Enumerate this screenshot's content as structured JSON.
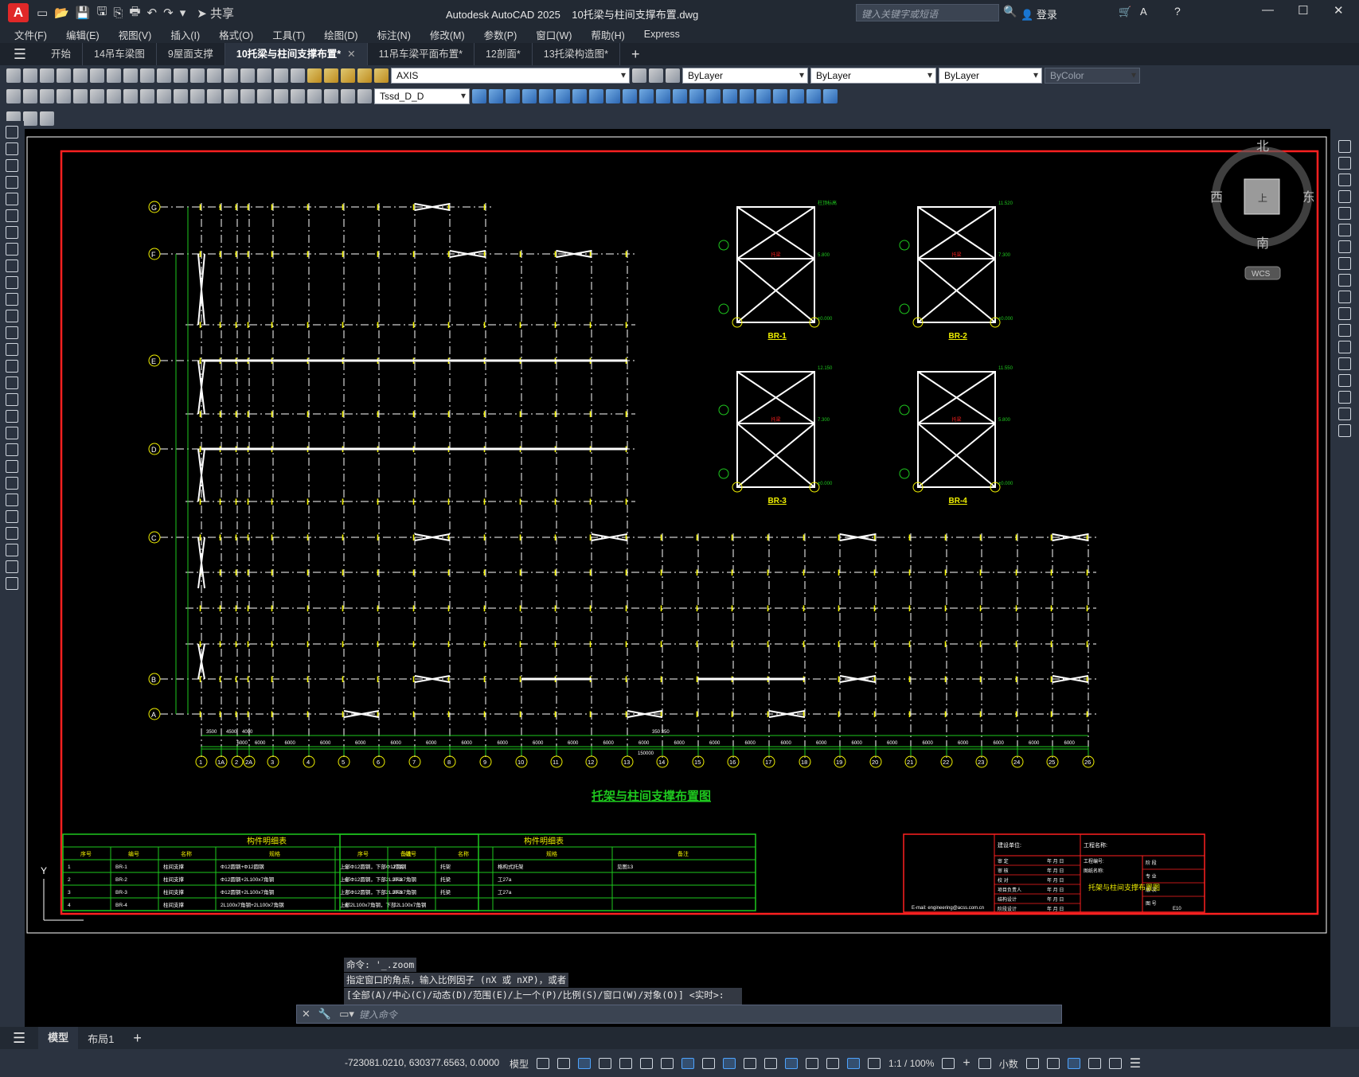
{
  "titlebar": {
    "logo": "A",
    "share": "共享",
    "app_title": "Autodesk AutoCAD 2025",
    "file_title": "10托梁与柱间支撑布置.dwg",
    "search_placeholder": "键入关键字或短语",
    "login": "登录"
  },
  "menu": [
    "文件(F)",
    "编辑(E)",
    "视图(V)",
    "插入(I)",
    "格式(O)",
    "工具(T)",
    "绘图(D)",
    "标注(N)",
    "修改(M)",
    "参数(P)",
    "窗口(W)",
    "帮助(H)",
    "Express"
  ],
  "tabs": [
    {
      "label": "开始"
    },
    {
      "label": "14吊车梁图"
    },
    {
      "label": "9屋面支撑"
    },
    {
      "label": "10托梁与柱间支撑布置*",
      "active": true
    },
    {
      "label": "11吊车梁平面布置*"
    },
    {
      "label": "12剖面*"
    },
    {
      "label": "13托梁构造图*"
    }
  ],
  "toolbar": {
    "layer": "AXIS",
    "color": "ByLayer",
    "linetype": "ByLayer",
    "lineweight": "ByLayer",
    "plotstyle": "ByColor",
    "dimstyle": "Tssd_D_D"
  },
  "compass": {
    "north": "北",
    "south": "南",
    "east": "东",
    "west": "西",
    "wcs": "WCS"
  },
  "drawing": {
    "title": "托架与柱间支撑布置图",
    "row_axes": [
      "G",
      "F",
      "E",
      "D",
      "C",
      "B",
      "A"
    ],
    "col_axes": [
      "1",
      "1A",
      "2",
      "2A",
      "3",
      "4",
      "5",
      "6",
      "7",
      "8",
      "9",
      "10",
      "11",
      "12",
      "13",
      "14",
      "15",
      "16",
      "17",
      "18",
      "19",
      "20",
      "21",
      "22",
      "23",
      "24",
      "25",
      "26"
    ],
    "bay_dims_top": [
      "3500",
      "4500",
      "4000"
    ],
    "bay_dims": [
      "6000",
      "6000",
      "6000",
      "6000",
      "6000",
      "6000",
      "6000",
      "6000",
      "6000",
      "6000",
      "6000",
      "6000",
      "6000",
      "6000",
      "6000",
      "6000",
      "6000",
      "6000",
      "6000",
      "6000",
      "6000",
      "6000",
      "6000",
      "6000",
      "6000"
    ],
    "total_dim": "150000",
    "mid_dim": "350 350",
    "elevations": [
      {
        "name": "BR-1",
        "top": "柱顶标高",
        "mid": "5.800",
        "base": "±0.000",
        "mid_label": "托梁"
      },
      {
        "name": "BR-2",
        "top": "11.520",
        "mid": "7.300",
        "base": "±0.000",
        "mid_label": "托梁"
      },
      {
        "name": "BR-3",
        "top": "12.150",
        "mid": "7.300",
        "base": "±0.000",
        "mid_label": "托梁"
      },
      {
        "name": "BR-4",
        "top": "11.550",
        "mid": "5.800",
        "base": "±0.000",
        "mid_label": "托梁"
      }
    ],
    "table1_title": "构件明细表",
    "table1_headers": [
      "序号",
      "编号",
      "名称",
      "规格",
      "备注"
    ],
    "table1_rows": [
      [
        "1",
        "BR-1",
        "柱间支撑",
        "Φ12圆钢+Φ12圆钢",
        "上部Φ12圆钢，下部Φ12圆钢"
      ],
      [
        "2",
        "BR-2",
        "柱间支撑",
        "Φ12圆钢+2L100x7角钢",
        "上部Φ12圆钢，下部2L100x7角钢"
      ],
      [
        "3",
        "BR-3",
        "柱间支撑",
        "Φ12圆钢+2L100x7角钢",
        "上部Φ12圆钢，下部2L100x7角钢"
      ],
      [
        "4",
        "BR-4",
        "柱间支撑",
        "2L100x7角钢+2L100x7角钢",
        "上部2L100x7角钢，下部2L100x7角钢"
      ]
    ],
    "table2_title": "构件明细表",
    "table2_headers": [
      "序号",
      "编号",
      "名称",
      "规格",
      "备注"
    ],
    "table2_rows": [
      [
        "5",
        "JT-1",
        "托架",
        "格构式托架",
        "见图13"
      ],
      [
        "6",
        "JT-2",
        "托梁",
        "工27a",
        ""
      ],
      [
        "7",
        "JT-3",
        "托梁",
        "工27a",
        ""
      ],
      [
        "8",
        "",
        "",
        "",
        ""
      ]
    ],
    "titleblock": {
      "builder": "建设单位:",
      "project": "工程名称:",
      "title": "托架与柱间支撑布置图",
      "rows": [
        "审 定",
        "审 核",
        "校 对",
        "项目负责人",
        "结构设计",
        "阶段设计"
      ],
      "date": "年 月 日",
      "right_labels": [
        "阶 段",
        "专 业",
        "版 次",
        "图 号"
      ],
      "sheet": "E10",
      "project_no": "工程编号:",
      "drawing_name": "图纸名称:",
      "email": "E-mail: engineering@acss.com.cn"
    }
  },
  "command": {
    "history": [
      "命令: '_.zoom",
      "指定窗口的角点，输入比例因子 (nX 或 nXP)，或者",
      "[全部(A)/中心(C)/动态(D)/范围(E)/上一个(P)/比例(S)/窗口(W)/对象(O)] <实时>: _e"
    ],
    "placeholder": "键入命令"
  },
  "layouts": {
    "model": "模型",
    "layout1": "布局1"
  },
  "status": {
    "coords": "-723081.0210, 630377.6563, 0.0000",
    "model": "模型",
    "scale": "1:1 / 100%",
    "units": "小数"
  }
}
